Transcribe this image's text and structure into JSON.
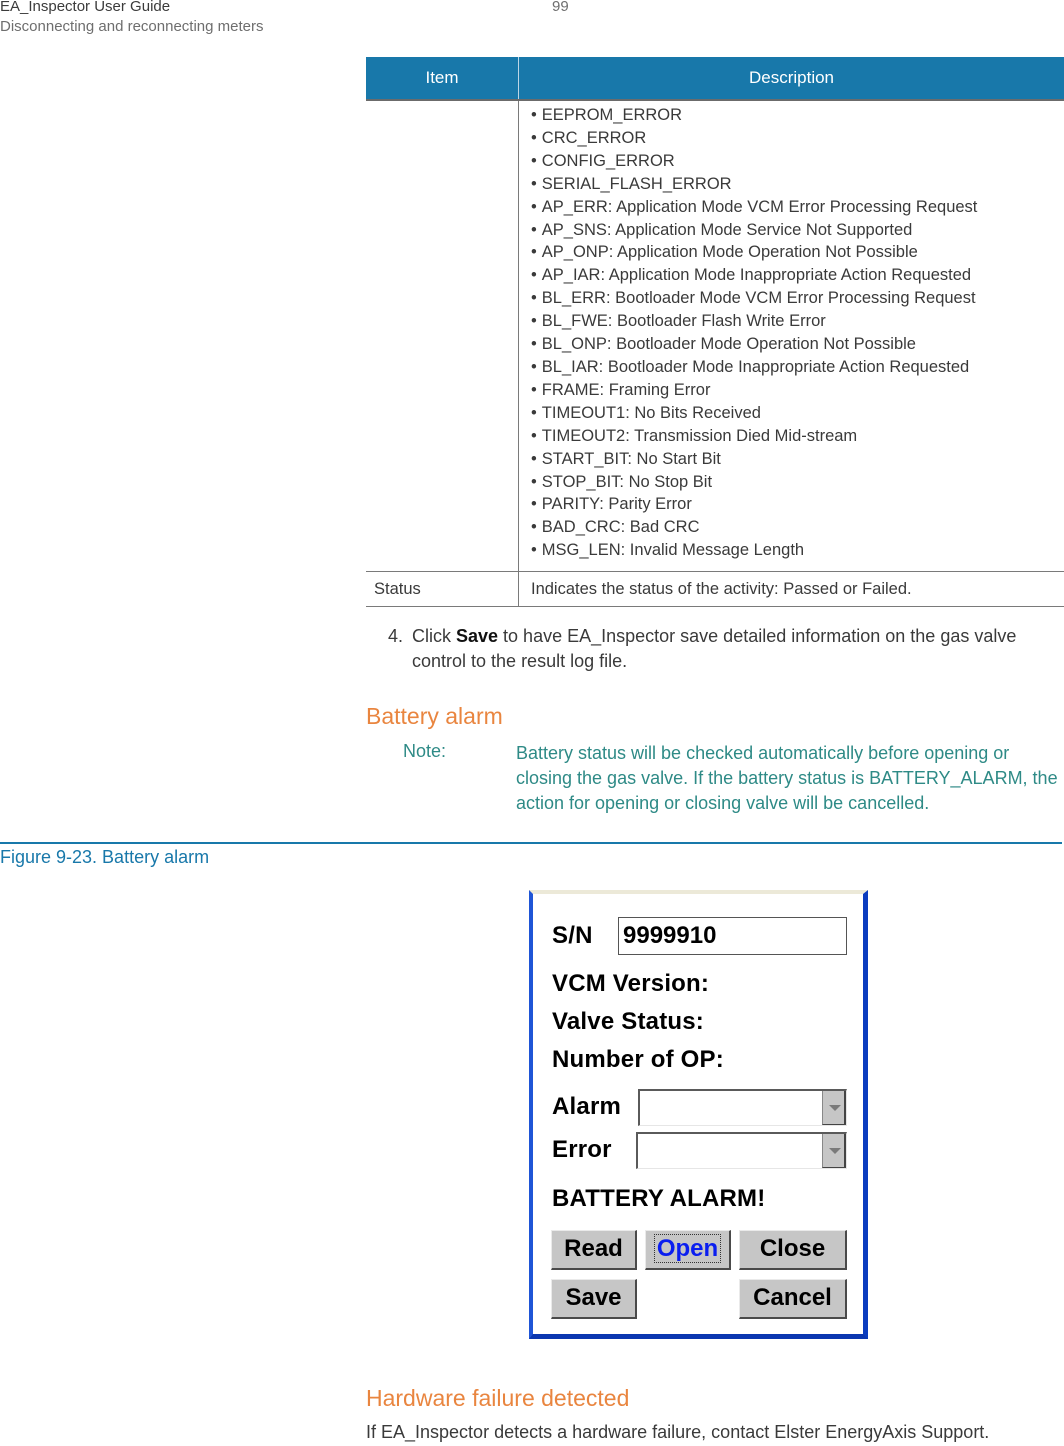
{
  "header": {
    "doc_title": "EA_Inspector User Guide",
    "section": "Disconnecting and reconnecting meters",
    "page_number": "99"
  },
  "table": {
    "columns": [
      "Item",
      "Description"
    ],
    "rows": [
      {
        "item": "",
        "codes": [
          "EEPROM_ERROR",
          "CRC_ERROR",
          "CONFIG_ERROR",
          "SERIAL_FLASH_ERROR",
          "AP_ERR: Application Mode VCM Error Processing Request",
          "AP_SNS: Application Mode Service Not Supported",
          "AP_ONP: Application Mode Operation Not Possible",
          "AP_IAR: Application Mode Inappropriate Action Requested",
          "BL_ERR: Bootloader Mode VCM Error Processing Request",
          "BL_FWE: Bootloader Flash Write Error",
          "BL_ONP: Bootloader Mode Operation Not Possible",
          "BL_IAR: Bootloader Mode Inappropriate Action Requested",
          "FRAME: Framing Error",
          "TIMEOUT1: No Bits Received",
          "TIMEOUT2: Transmission Died Mid-stream",
          "START_BIT: No Start Bit",
          "STOP_BIT: No Stop Bit",
          "PARITY: Parity Error",
          "BAD_CRC: Bad CRC",
          "MSG_LEN: Invalid Message Length"
        ]
      },
      {
        "item": "Status",
        "description": "Indicates the status of the activity: Passed or Failed."
      }
    ]
  },
  "step4": {
    "number": "4.",
    "prefix": "Click ",
    "emphasis": "Save",
    "line1_rest": " to have EA_Inspector save detailed information on the gas valve",
    "line2": "control to the result log file."
  },
  "battery_section": {
    "heading": "Battery alarm",
    "note_label": "Note:",
    "note_text": "Battery status will be checked automatically before opening or closing the gas valve. If the battery status is BATTERY_ALARM, the action for opening or closing valve will be cancelled."
  },
  "figure": {
    "caption": "Figure 9-23. Battery alarm",
    "dialog": {
      "sn_label": "S/N",
      "sn_value": "9999910",
      "vcm_version_label": "VCM Version:",
      "valve_status_label": "Valve Status:",
      "number_of_op_label": "Number of OP:",
      "alarm_label": "Alarm",
      "alarm_value": "",
      "error_label": "Error",
      "error_value": "",
      "status_message": "BATTERY ALARM!",
      "buttons": {
        "read": "Read",
        "open": "Open",
        "close": "Close",
        "save": "Save",
        "cancel": "Cancel"
      },
      "focused_button": "open"
    }
  },
  "hardware_section": {
    "heading": "Hardware failure detected",
    "text": "If EA_Inspector detects a hardware failure, contact Elster EnergyAxis Support."
  },
  "colors": {
    "table_header": "#1878aa",
    "heading_orange": "#e9853f",
    "note_teal": "#2e8a86",
    "figure_blue": "#1878aa",
    "focused_button_text": "#0a1ef0"
  }
}
